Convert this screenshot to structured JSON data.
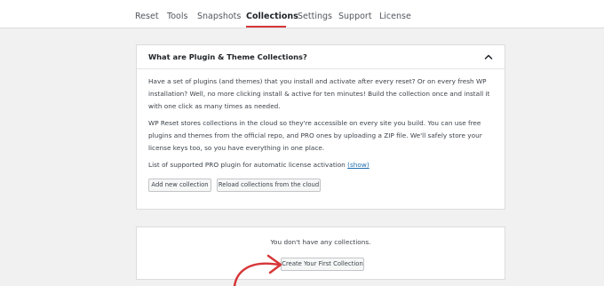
{
  "tabs": [
    {
      "label": "Reset"
    },
    {
      "label": "Tools"
    },
    {
      "label": "Snapshots"
    },
    {
      "label": "Collections"
    },
    {
      "label": "Settings"
    },
    {
      "label": "Support"
    },
    {
      "label": "License"
    }
  ],
  "active_tab": "Collections",
  "info_card": {
    "title": "What are Plugin & Theme Collections?",
    "paragraph1": "Have a set of plugins (and themes) that you install and activate after every reset? Or on every fresh WP installation? Well, no more clicking install & active for ten minutes! Build the collection once and install it with one click as many times as needed.",
    "paragraph2": "WP Reset stores collections in the cloud so they're accessible on every site you build. You can use free plugins and themes from the official repo, and PRO ones by uploading a ZIP file. We'll safely store your license keys too, so you have everything in one place.",
    "paragraph3_text": "List of supported PRO plugin for automatic license activation",
    "paragraph3_link": "(show)",
    "add_button": "Add new collection",
    "reload_button": "Reload collections from the cloud"
  },
  "empty_card": {
    "message": "You don't have any collections.",
    "create_button": "Create Your First Collection"
  },
  "colors": {
    "accent_red": "#d63638",
    "link_blue": "#2271b1",
    "background": "#f1f1f1"
  },
  "icons": {
    "collapse": "chevron-up-icon",
    "annotation": "red-arrow"
  }
}
